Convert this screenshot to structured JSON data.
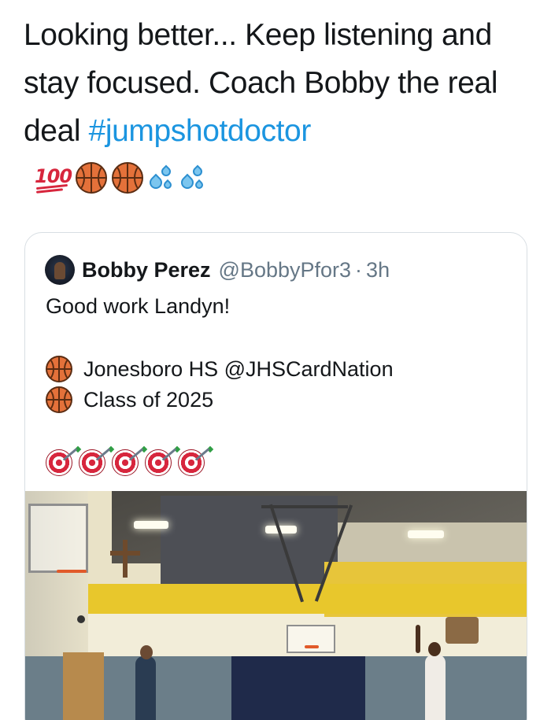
{
  "tweet": {
    "text": "Looking better... Keep listening and stay focused. Coach Bobby the real deal ",
    "hashtag": "#jumpshotdoctor",
    "emojis": [
      "hundred-points-icon",
      "basketball-icon",
      "basketball-icon",
      "sweat-droplets-icon",
      "sweat-droplets-icon"
    ],
    "hundred_label": "100"
  },
  "quote": {
    "display_name": "Bobby Perez",
    "handle": "@BobbyPfor3",
    "separator": "·",
    "time": "3h",
    "text": "Good work Landyn!",
    "items": [
      {
        "icon": "basketball-icon",
        "label": "Jonesboro HS @JHSCardNation"
      },
      {
        "icon": "basketball-icon",
        "label": "Class of 2025"
      }
    ],
    "targets": [
      "direct-hit-icon",
      "direct-hit-icon",
      "direct-hit-icon",
      "direct-hit-icon",
      "direct-hit-icon"
    ]
  },
  "colors": {
    "text": "#14171a",
    "hashtag": "#1b95e0",
    "secondary": "#657786",
    "border": "#d8dee3"
  }
}
